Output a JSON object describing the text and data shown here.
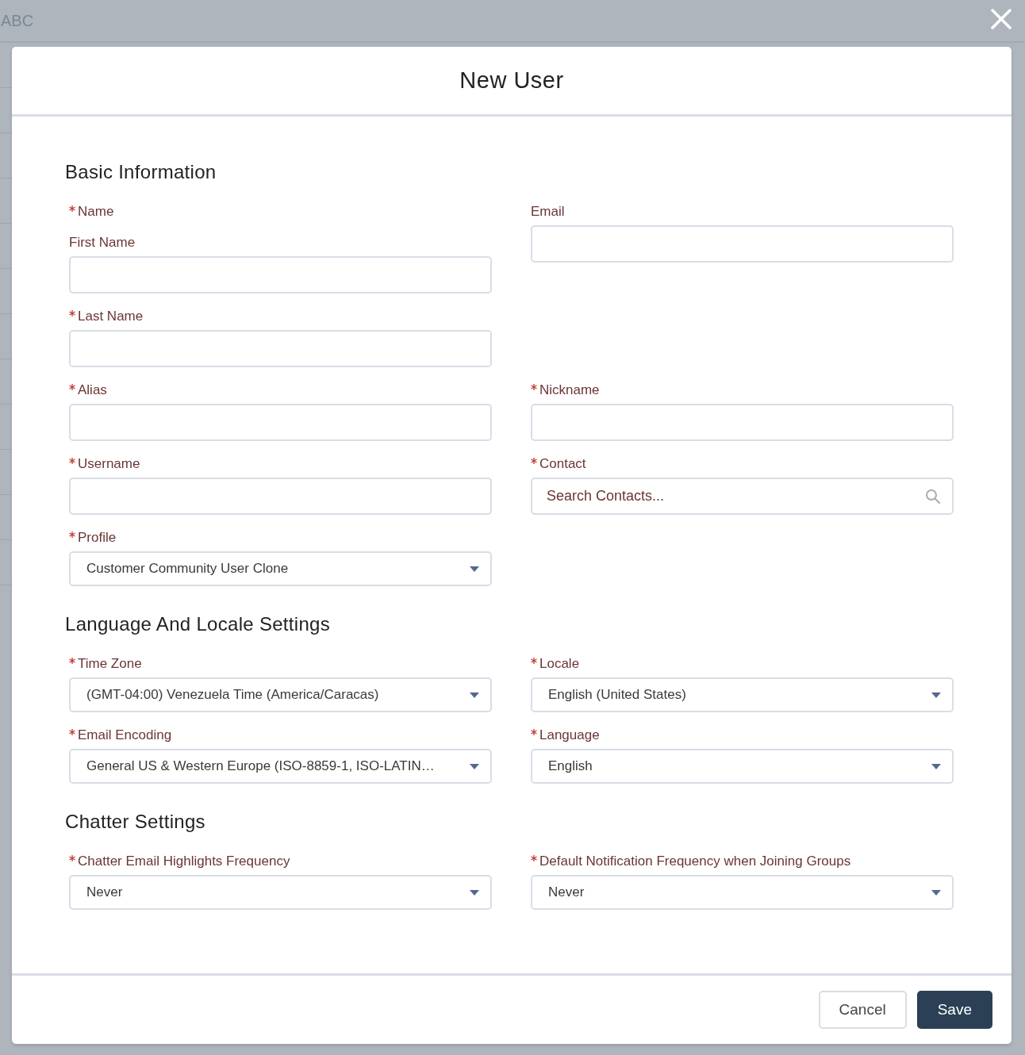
{
  "background": {
    "title": "ABC"
  },
  "modal": {
    "title": "New User",
    "sections": [
      {
        "title": "Basic Information",
        "rows": [
          {
            "left": {
              "kind": "group",
              "label": "Name",
              "required": true,
              "fields": [
                {
                  "kind": "text",
                  "label": "First Name",
                  "required": false
                },
                {
                  "kind": "text",
                  "label": "Last Name",
                  "required": true
                }
              ]
            },
            "right": {
              "kind": "text",
              "label": "Email",
              "required": false
            }
          },
          {
            "left": {
              "kind": "text",
              "label": "Alias",
              "required": true
            },
            "right": {
              "kind": "text",
              "label": "Nickname",
              "required": true
            }
          },
          {
            "left": {
              "kind": "text",
              "label": "Username",
              "required": true
            },
            "right": {
              "kind": "lookup",
              "label": "Contact",
              "required": true,
              "placeholder": "Search Contacts..."
            }
          },
          {
            "left": {
              "kind": "select",
              "label": "Profile",
              "required": true,
              "value": "Customer Community User Clone"
            }
          }
        ]
      },
      {
        "title": "Language And Locale Settings",
        "rows": [
          {
            "left": {
              "kind": "select",
              "label": "Time Zone",
              "required": true,
              "value": "(GMT-04:00) Venezuela Time (America/Caracas)"
            },
            "right": {
              "kind": "select",
              "label": "Locale",
              "required": true,
              "value": "English (United States)"
            }
          },
          {
            "left": {
              "kind": "select",
              "label": "Email Encoding",
              "required": true,
              "value": "General US & Western Europe (ISO-8859-1, ISO-LATIN…"
            },
            "right": {
              "kind": "select",
              "label": "Language",
              "required": true,
              "value": "English"
            }
          }
        ]
      },
      {
        "title": "Chatter Settings",
        "rows": [
          {
            "left": {
              "kind": "select",
              "label": "Chatter Email Highlights Frequency",
              "required": true,
              "value": "Never"
            },
            "right": {
              "kind": "select",
              "label": "Default Notification Frequency when Joining Groups",
              "required": true,
              "value": "Never"
            }
          }
        ]
      }
    ],
    "buttons": [
      {
        "kind": "neutral",
        "label": "Cancel"
      },
      {
        "kind": "brand",
        "label": "Save"
      }
    ]
  }
}
